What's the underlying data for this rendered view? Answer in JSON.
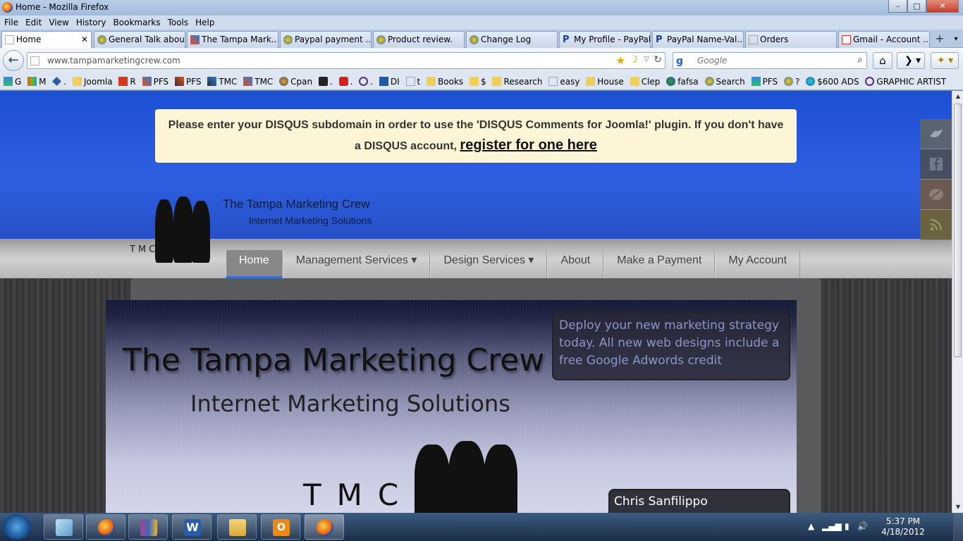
{
  "window": {
    "title": "Home - Mozilla Firefox",
    "min": "–",
    "max": "□",
    "close": "✕"
  },
  "menubar": [
    "File",
    "Edit",
    "View",
    "History",
    "Bookmarks",
    "Tools",
    "Help"
  ],
  "tabs": [
    {
      "label": "Home",
      "close": "✕"
    },
    {
      "label": "General Talk abou..."
    },
    {
      "label": "The Tampa Mark..."
    },
    {
      "label": "Paypal payment ..."
    },
    {
      "label": "Product review."
    },
    {
      "label": "Change Log"
    },
    {
      "label": "My Profile - PayPal"
    },
    {
      "label": "PayPal Name-Val..."
    },
    {
      "label": "Orders"
    },
    {
      "label": "Gmail - Account ..."
    }
  ],
  "tab_new": "+",
  "tab_list": "▾",
  "nav": {
    "url": "www.tampamarketingcrew.com",
    "search_placeholder": "Google",
    "back": "←",
    "star": "★",
    "moon": "☽",
    "dropdown": "▽",
    "reload": "↻",
    "search_engine": "g",
    "magnifier": "⌕",
    "home": "⌂",
    "chevron": "❯ ▾",
    "addon": "✦ ▾"
  },
  "bookmarks": [
    "G",
    "M",
    ".",
    "Joomla",
    "R",
    "PFS",
    "PFS",
    "TMC",
    "TMC",
    "Cpan",
    ".",
    ".",
    ".",
    "DI",
    "t",
    "Books",
    "$",
    "Research",
    "easy",
    "House",
    "Clep",
    "fafsa",
    "Search",
    "PFS",
    "?",
    "$600 ADS",
    "GRAPHIC ARTIST"
  ],
  "notice": {
    "text": "Please enter your DISQUS subdomain in order to use the 'DISQUS Comments for Joomla!' plugin. If you don't have a DISQUS account,",
    "link": "register for one here"
  },
  "logo": {
    "title": "The Tampa Marketing Crew",
    "subtitle": "Internet Marketing Solutions",
    "tmc": "TMC"
  },
  "menu": [
    "Home",
    "Management Services ▾",
    "Design Services ▾",
    "About",
    "Make a Payment",
    "My Account"
  ],
  "slide": {
    "title": "The Tampa Marketing Crew",
    "subtitle": "Internet Marketing Solutions",
    "tmc": "TMC",
    "caption": "Deploy your new marketing strategy today. All new web designs include a free Google Adwords credit",
    "caption2": "Chris Sanfilippo"
  },
  "scrollbar": {
    "up": "▲",
    "down": "▼"
  },
  "tray": {
    "time": "5:37 PM",
    "date": "4/18/2012",
    "arrow": "▲",
    "signal": "▂▄▆",
    "battery": "▮",
    "volume": "🔊"
  }
}
